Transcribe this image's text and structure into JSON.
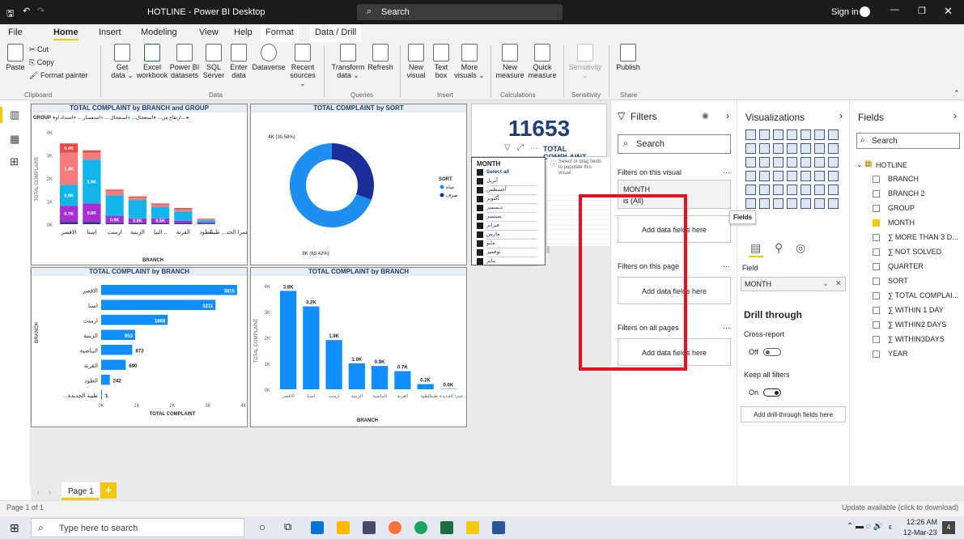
{
  "window": {
    "title": "HOTLINE - Power BI Desktop",
    "search_placeholder": "Search",
    "sign_in": "Sign in"
  },
  "menu": {
    "items": [
      "File",
      "Home",
      "Insert",
      "Modeling",
      "View",
      "Help",
      "Format",
      "Data / Drill"
    ],
    "active": "Home"
  },
  "ribbon": {
    "clipboard": {
      "paste": "Paste",
      "cut": "Cut",
      "copy": "Copy",
      "format_painter": "Format painter",
      "group": "Clipboard"
    },
    "data": {
      "buttons": [
        "Get data ⌄",
        "Excel workbook",
        "Power BI datasets",
        "SQL Server",
        "Enter data",
        "Dataverse",
        "Recent sources ⌄"
      ],
      "group": "Data"
    },
    "queries": {
      "buttons": [
        "Transform data ⌄",
        "Refresh"
      ],
      "group": "Queries"
    },
    "insert": {
      "buttons": [
        "New visual",
        "Text box",
        "More visuals ⌄"
      ],
      "group": "Insert"
    },
    "calculations": {
      "buttons": [
        "New measure",
        "Quick measure"
      ],
      "group": "Calculations"
    },
    "sensitivity": {
      "buttons": [
        "Sensitivity ⌄"
      ],
      "group": "Sensitivity"
    },
    "share": {
      "buttons": [
        "Publish"
      ],
      "group": "Share"
    }
  },
  "visuals": {
    "v1": {
      "title": "TOTAL COMPLAINT by BRANCH and GROUP",
      "legend_label": "GROUP",
      "legend_items": [
        "ارتفاع من...",
        "استعجال...",
        "استعجال ...",
        "استفسار ...",
        "استداد او..."
      ],
      "xlabel": "BRANCH",
      "ylabel": "TOTAL COMPLAINT"
    },
    "v2": {
      "title": "TOTAL COMPLAINT by SORT",
      "legend_label": "SORT",
      "legend_items": [
        "مياه",
        "صرف"
      ],
      "label_big": "8K (69.42%)",
      "label_small": "4K (30.58%)"
    },
    "card": {
      "value": "11653",
      "label": "TOTAL COMPLAINT"
    },
    "slicer": {
      "header": "MONTH",
      "items": [
        "Select all",
        "أبريل",
        "أغسطس",
        "أكتوبر",
        "ديسمبر",
        "سبتمبر",
        "فبراير",
        "مارس",
        "مايو",
        "نوفمبر",
        "يناير"
      ]
    },
    "tooltip": {
      "text": "Select or drag fields to populate this visual"
    },
    "v3": {
      "title": "TOTAL COMPLAINT by BRANCH",
      "xlabel": "TOTAL COMPLAINT",
      "ylabel": "BRANCH"
    },
    "v4": {
      "title": "TOTAL COMPLAINT by BRANCH",
      "xlabel": "BRANCH",
      "ylabel": "TOTAL COMPLAINT"
    }
  },
  "chart_data": [
    {
      "type": "bar",
      "title": "TOTAL COMPLAINT by BRANCH and GROUP",
      "categories": [
        "الاقصر",
        "اسنا",
        "ارمنت",
        "الزينية",
        "البيا...",
        "القرنة",
        "الطود",
        "عمرا الجد... طيبة"
      ],
      "stacked": true,
      "series": [
        {
          "name": "ارتفاع من...",
          "color": "#2b3a8f",
          "values": [
            0.1,
            0.1,
            0.05,
            0.05,
            0.05,
            0.05,
            0.02,
            0
          ]
        },
        {
          "name": "استعجال...",
          "color": "#a52fd1",
          "values": [
            0.7,
            0.8,
            0.3,
            0.2,
            0.2,
            0.1,
            0.05,
            0
          ]
        },
        {
          "name": "استعجال ...",
          "color": "#12b5e8",
          "values": [
            0.9,
            1.9,
            0.9,
            0.8,
            0.5,
            0.4,
            0.1,
            0
          ]
        },
        {
          "name": "استفسار ...",
          "color": "#f47c7c",
          "values": [
            1.4,
            0.3,
            0.2,
            0.1,
            0.1,
            0.1,
            0.05,
            0
          ]
        },
        {
          "name": "استداد او...",
          "color": "#e84b4b",
          "values": [
            0.4,
            0.1,
            0.05,
            0.05,
            0.05,
            0.05,
            0.02,
            0
          ]
        }
      ],
      "data_labels": [
        [
          "0.7K",
          "0.9K",
          "1.4K",
          "0.4K"
        ],
        [
          "0.8K",
          "1.9K"
        ],
        [
          "0.9K"
        ],
        [
          "0.8K"
        ],
        [
          "0.5K"
        ]
      ],
      "xlabel": "BRANCH",
      "ylabel": "TOTAL COMPLAINT",
      "yticks": [
        "4K",
        "3K",
        "2K",
        "1K",
        "0K"
      ],
      "ylim": [
        0,
        4
      ]
    },
    {
      "type": "pie",
      "title": "TOTAL COMPLAINT by SORT",
      "categories": [
        "مياه",
        "صرف"
      ],
      "values": [
        69.42,
        30.58
      ],
      "colors": [
        "#1e8fef",
        "#1a2e9a"
      ],
      "labels": [
        "8K (69.42%)",
        "4K (30.58%)"
      ]
    },
    {
      "type": "bar",
      "orientation": "horizontal",
      "title": "TOTAL COMPLAINT by BRANCH",
      "categories": [
        "الاقصر",
        "اسنا",
        "ارمنت",
        "الزينية",
        "البياضية",
        "القرنة",
        "الطود",
        "...طيبة الجديدة"
      ],
      "values": [
        3815,
        3211,
        1868,
        953,
        873,
        690,
        242,
        1
      ],
      "xticks": [
        "0K",
        "1K",
        "2K",
        "3K",
        "4K"
      ],
      "xlim": [
        0,
        4000
      ],
      "xlabel": "TOTAL COMPLAINT",
      "ylabel": "BRANCH"
    },
    {
      "type": "bar",
      "title": "TOTAL COMPLAINT by BRANCH",
      "categories": [
        "الاقصر",
        "اسنا",
        "ارمنت",
        "الزينية",
        "البياضية",
        "القرنة",
        "الطود",
        "عمرا الجديدة طيبة..."
      ],
      "values": [
        3.8,
        3.2,
        1.9,
        1.0,
        0.9,
        0.7,
        0.2,
        0.0
      ],
      "labels": [
        "3.8K",
        "3.2K",
        "1.9K",
        "1.0K",
        "0.9K",
        "0.7K",
        "0.2K",
        "0.0K"
      ],
      "yticks": [
        "4K",
        "3K",
        "2K",
        "1K",
        "0K"
      ],
      "ylim": [
        0,
        4
      ],
      "xlabel": "BRANCH",
      "ylabel": "TOTAL COMPLAINT"
    }
  ],
  "filters_pane": {
    "title": "Filters",
    "search": "Search",
    "on_visual": "Filters on this visual",
    "month_card": "MONTH",
    "month_is": "is (All)",
    "add_here": "Add data fields here",
    "on_page": "Filters on this page",
    "on_all": "Filters on all pages"
  },
  "viz_pane": {
    "title": "Visualizations",
    "fields_tooltip": "Fields",
    "field_label": "Field",
    "field_value": "MONTH",
    "drill_through": "Drill through",
    "cross_report": "Cross-report",
    "off": "Off",
    "keep_filters": "Keep all filters",
    "on": "On",
    "add_drill": "Add drill-through fields here"
  },
  "fields_pane": {
    "title": "Fields",
    "search": "Search",
    "table": "HOTLINE",
    "fields": [
      {
        "name": "BRANCH",
        "checked": false
      },
      {
        "name": "BRANCH 2",
        "checked": false
      },
      {
        "name": "GROUP",
        "checked": false
      },
      {
        "name": "MONTH",
        "checked": true
      },
      {
        "name": "∑ MORE THAN 3 D...",
        "checked": false
      },
      {
        "name": "∑ NOT SOLVED",
        "checked": false
      },
      {
        "name": "QUARTER",
        "checked": false
      },
      {
        "name": "SORT",
        "checked": false
      },
      {
        "name": "∑ TOTAL COMPLAI...",
        "checked": false
      },
      {
        "name": "∑ WITHIN 1 DAY",
        "checked": false
      },
      {
        "name": "∑ WITHIN2 DAYS",
        "checked": false
      },
      {
        "name": "∑ WITHIN3DAYS",
        "checked": false
      },
      {
        "name": "YEAR",
        "checked": false
      }
    ]
  },
  "pages": {
    "tab": "Page 1",
    "add": "+"
  },
  "status": {
    "left": "Page 1 of 1",
    "right": "Update available (click to download)"
  },
  "taskbar": {
    "search": "Type here to search",
    "time": "12:26 AM",
    "date": "12-Mar-23",
    "badge": "4"
  },
  "highlight_color": "#e81123"
}
